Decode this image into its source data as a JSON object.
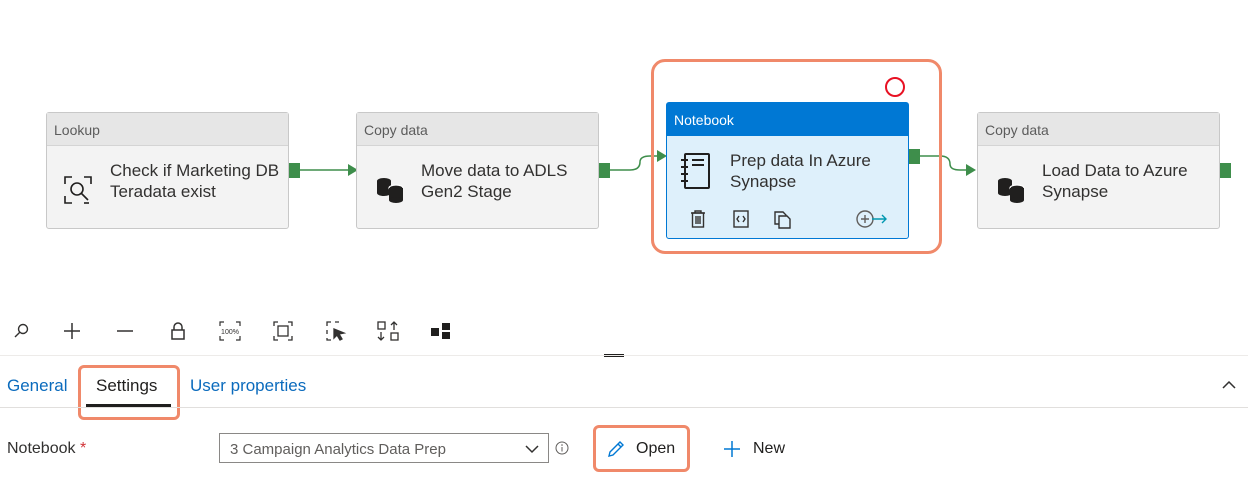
{
  "activities": [
    {
      "type": "Lookup",
      "name": "Check if Marketing DB Teradata exist",
      "icon": "lookup-icon"
    },
    {
      "type": "Copy data",
      "name": "Move data to ADLS Gen2 Stage",
      "icon": "database-icon"
    },
    {
      "type": "Notebook",
      "name": "Prep data In Azure Synapse",
      "icon": "notebook-icon",
      "selected": true
    },
    {
      "type": "Copy data",
      "name": "Load Data to Azure Synapse",
      "icon": "database-icon"
    }
  ],
  "activity_lines": [
    [
      "Check if Marketing DB",
      "Teradata exist"
    ],
    [
      "Move data to ADLS",
      "Gen2 Stage"
    ],
    [
      "Prep data In Azure",
      "Synapse"
    ],
    [
      "Load Data to Azure",
      "Synapse"
    ]
  ],
  "toolbar": {
    "items": [
      "search-icon",
      "zoom-in-icon",
      "zoom-out-icon",
      "lock-icon",
      "zoom-100-icon",
      "fit-to-screen-icon",
      "select-icon",
      "auto-align-icon",
      "layout-icon"
    ],
    "zoom100_text": "100%"
  },
  "tabs": [
    {
      "label": "General",
      "active": false
    },
    {
      "label": "Settings",
      "active": true
    },
    {
      "label": "User properties",
      "active": false
    }
  ],
  "settings": {
    "notebook_label": "Notebook",
    "required_mark": "*",
    "notebook_value": "3 Campaign Analytics Data Prep",
    "open_label": "Open",
    "new_label": "New"
  },
  "colors": {
    "accent": "#0078d4",
    "highlight": "#f0896a",
    "port": "#3e8e4b",
    "link": "#0b6bbd",
    "error": "#e81123"
  }
}
